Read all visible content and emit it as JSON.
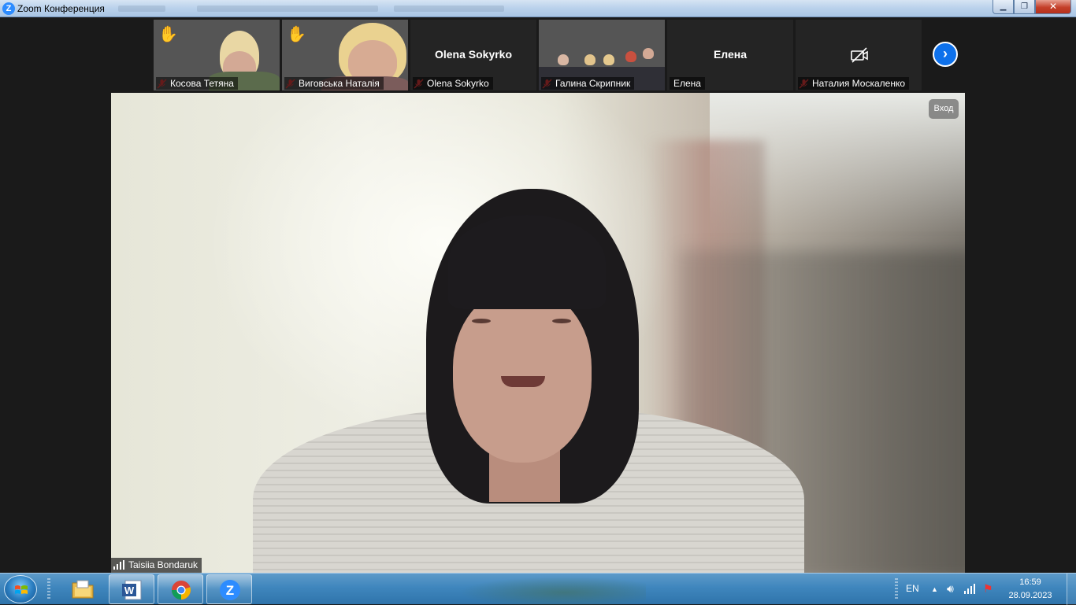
{
  "window": {
    "title": "Zoom Конференция",
    "app_icon": "zoom-icon",
    "controls": {
      "minimize": "minimize-icon",
      "maximize": "restore-icon",
      "close": "close-icon"
    }
  },
  "participants": [
    {
      "name": "Косова Тетяна",
      "muted": true,
      "hand_raised": true,
      "video": true
    },
    {
      "name": "Виговська Наталія",
      "muted": true,
      "hand_raised": true,
      "video": true
    },
    {
      "name": "Olena Sokyrko",
      "muted": true,
      "hand_raised": false,
      "video": false,
      "display_name": "Olena Sokyrko"
    },
    {
      "name": "Галина Скрипник",
      "muted": true,
      "hand_raised": false,
      "video": true
    },
    {
      "name": "Елена",
      "muted": false,
      "hand_raised": false,
      "video": false,
      "display_name": "Елена"
    },
    {
      "name": "Наталия Москаленко",
      "muted": true,
      "hand_raised": false,
      "video": false,
      "camera_off": true
    }
  ],
  "strip": {
    "next_icon": "chevron-right-icon"
  },
  "main_video": {
    "speaker_name": "Taisiia Bondaruk",
    "badge": "Вход",
    "signal_icon": "signal-bars-icon"
  },
  "taskbar": {
    "start_icon": "windows-start-icon",
    "apps": [
      {
        "name": "file-explorer-icon"
      },
      {
        "name": "word-icon"
      },
      {
        "name": "chrome-icon"
      },
      {
        "name": "zoom-icon"
      }
    ],
    "tray": {
      "language": "EN",
      "time": "16:59",
      "date": "28.09.2023"
    }
  },
  "colors": {
    "zoom_blue": "#0e71eb",
    "mute_red": "#e03a3a",
    "hand_yellow": "#f5b400",
    "taskbar_blue": "#3f86bd"
  }
}
